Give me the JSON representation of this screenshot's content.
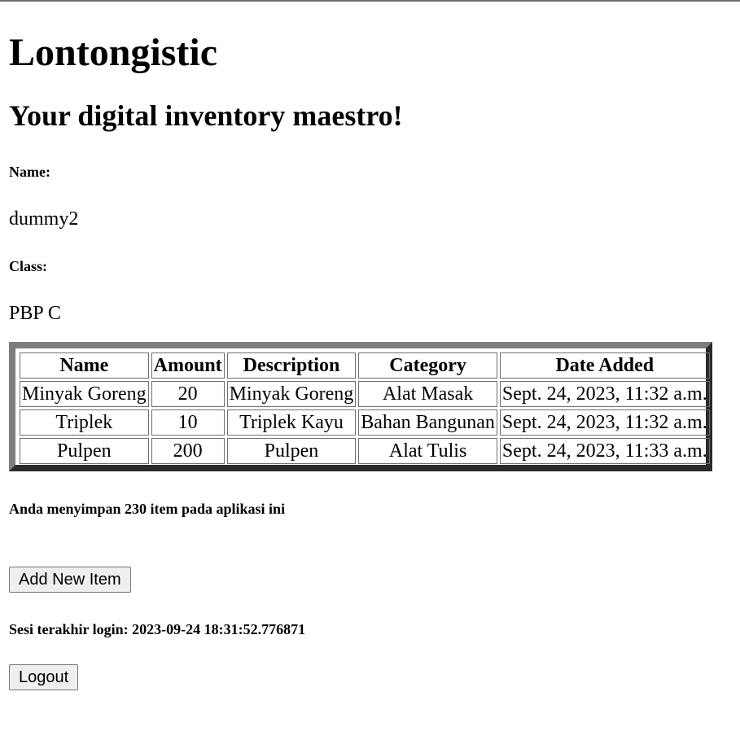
{
  "app": {
    "title": "Lontongistic",
    "tagline": "Your digital inventory maestro!"
  },
  "profile": {
    "name_label": "Name:",
    "name_value": "dummy2",
    "class_label": "Class:",
    "class_value": "PBP C"
  },
  "inventory_table": {
    "headers": [
      "Name",
      "Amount",
      "Description",
      "Category",
      "Date Added"
    ],
    "rows": [
      [
        "Minyak Goreng",
        "20",
        "Minyak Goreng",
        "Alat Masak",
        "Sept. 24, 2023, 11:32 a.m."
      ],
      [
        "Triplek",
        "10",
        "Triplek Kayu",
        "Bahan Bangunan",
        "Sept. 24, 2023, 11:32 a.m."
      ],
      [
        "Pulpen",
        "200",
        "Pulpen",
        "Alat Tulis",
        "Sept. 24, 2023, 11:33 a.m."
      ]
    ]
  },
  "summary_text": "Anda menyimpan 230 item pada aplikasi ini",
  "add_item_button": "Add New Item",
  "last_login_text": "Sesi terakhir login: 2023-09-24 18:31:52.776871",
  "logout_button": "Logout",
  "colors": {
    "table_border_light": "#7d7d7d",
    "table_border_dark": "#2b2b2b",
    "button_bg": "#efefef"
  }
}
